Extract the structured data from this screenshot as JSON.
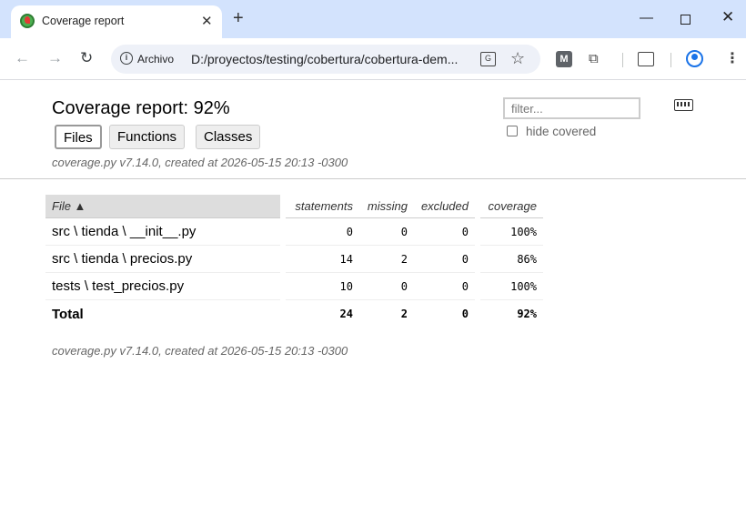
{
  "browser": {
    "tab_title": "Coverage report",
    "new_tab": "+",
    "omnibox_chip": "Archivo",
    "url": "D:/proyectos/testing/cobertura/cobertura-dem...",
    "window_controls": {
      "minimize": "—",
      "close": "✕"
    }
  },
  "report": {
    "title": "Coverage report: 92%",
    "buttons": {
      "files": "Files",
      "functions": "Functions",
      "classes": "Classes"
    },
    "meta": "coverage.py v7.14.0, created at 2026-05-15 20:13 -0300",
    "filter_placeholder": "filter...",
    "hide_covered_label": "hide covered"
  },
  "table": {
    "headers": {
      "file": "File ▲",
      "statements": "statements",
      "missing": "missing",
      "excluded": "excluded",
      "coverage": "coverage"
    },
    "rows": [
      {
        "file": "src \\ tienda \\ __init__.py",
        "statements": "0",
        "missing": "0",
        "excluded": "0",
        "coverage": "100%"
      },
      {
        "file": "src \\ tienda \\ precios.py",
        "statements": "14",
        "missing": "2",
        "excluded": "0",
        "coverage": "86%"
      },
      {
        "file": "tests \\ test_precios.py",
        "statements": "10",
        "missing": "0",
        "excluded": "0",
        "coverage": "100%"
      }
    ],
    "total": {
      "label": "Total",
      "statements": "24",
      "missing": "2",
      "excluded": "0",
      "coverage": "92%"
    }
  },
  "icons": [
    "favicon-icon",
    "close-tab-icon",
    "back-icon",
    "forward-icon",
    "reload-icon",
    "info-icon",
    "translate-icon",
    "star-icon",
    "extension-m-icon",
    "puzzle-icon",
    "cast-icon",
    "profile-icon",
    "menu-icon",
    "keyboard-icon"
  ]
}
